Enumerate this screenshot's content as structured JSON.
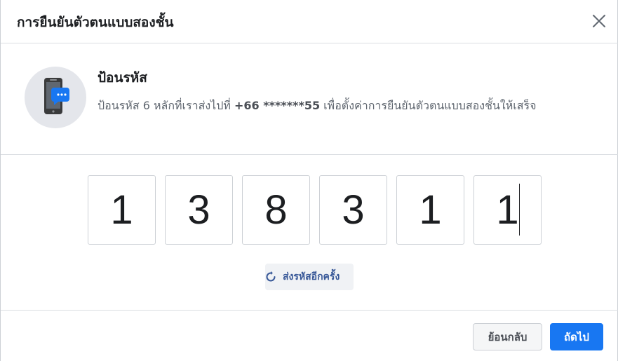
{
  "dialog": {
    "title": "การยืนยันตัวตนแบบสองชั้น"
  },
  "info": {
    "heading": "ป้อนรหัส",
    "desc_prefix": "ป้อนรหัส 6 หลักที่เราส่งไปที่ ",
    "phone": "+66 *******55",
    "desc_suffix": " เพื่อตั้งค่าการยืนยันตัวตนแบบสองชั้นให้เสร็จ",
    "icon": "phone-chat-icon"
  },
  "code": {
    "digits": [
      "1",
      "3",
      "8",
      "3",
      "1",
      "1"
    ]
  },
  "resend": {
    "label": "ส่งรหัสอีกครั้ง",
    "icon": "refresh-icon"
  },
  "footer": {
    "back_label": "ย้อนกลับ",
    "next_label": "ถัดไป"
  },
  "colors": {
    "primary": "#1877f2",
    "link": "#385898",
    "border": "#dadde1"
  }
}
